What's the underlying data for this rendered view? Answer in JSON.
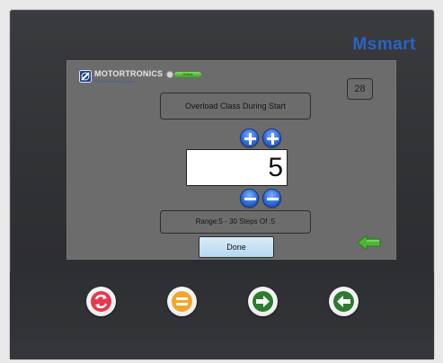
{
  "brand": "Msmart",
  "header": {
    "logo_text": "MOTORTRONICS",
    "logo_subtext": "Solid State Motor Control",
    "status_label": "Online",
    "counter": "28"
  },
  "editor": {
    "parameter_title": "Overload Class During Start",
    "value": "5",
    "range_text": "Range:5 - 30   Steps Of  :5",
    "done_label": "Done"
  },
  "colors": {
    "brand": "#2a63c7",
    "screen_bg": "#6c6c6c",
    "value_bg": "#ffffff",
    "round_btn": "#2f6be0",
    "done_btn": "#c6e3f6",
    "back_arrow": "#4db534",
    "hw_reset": "#e53a4f",
    "hw_menu": "#f4a52a",
    "hw_next": "#2e7c2e",
    "hw_back": "#2f7a31"
  },
  "icons": {
    "increment": "plus-icon",
    "decrement": "minus-icon",
    "back": "back-arrow-icon",
    "hardware": [
      "refresh-icon",
      "menu-icon",
      "arrow-right-icon",
      "arrow-left-icon"
    ]
  }
}
